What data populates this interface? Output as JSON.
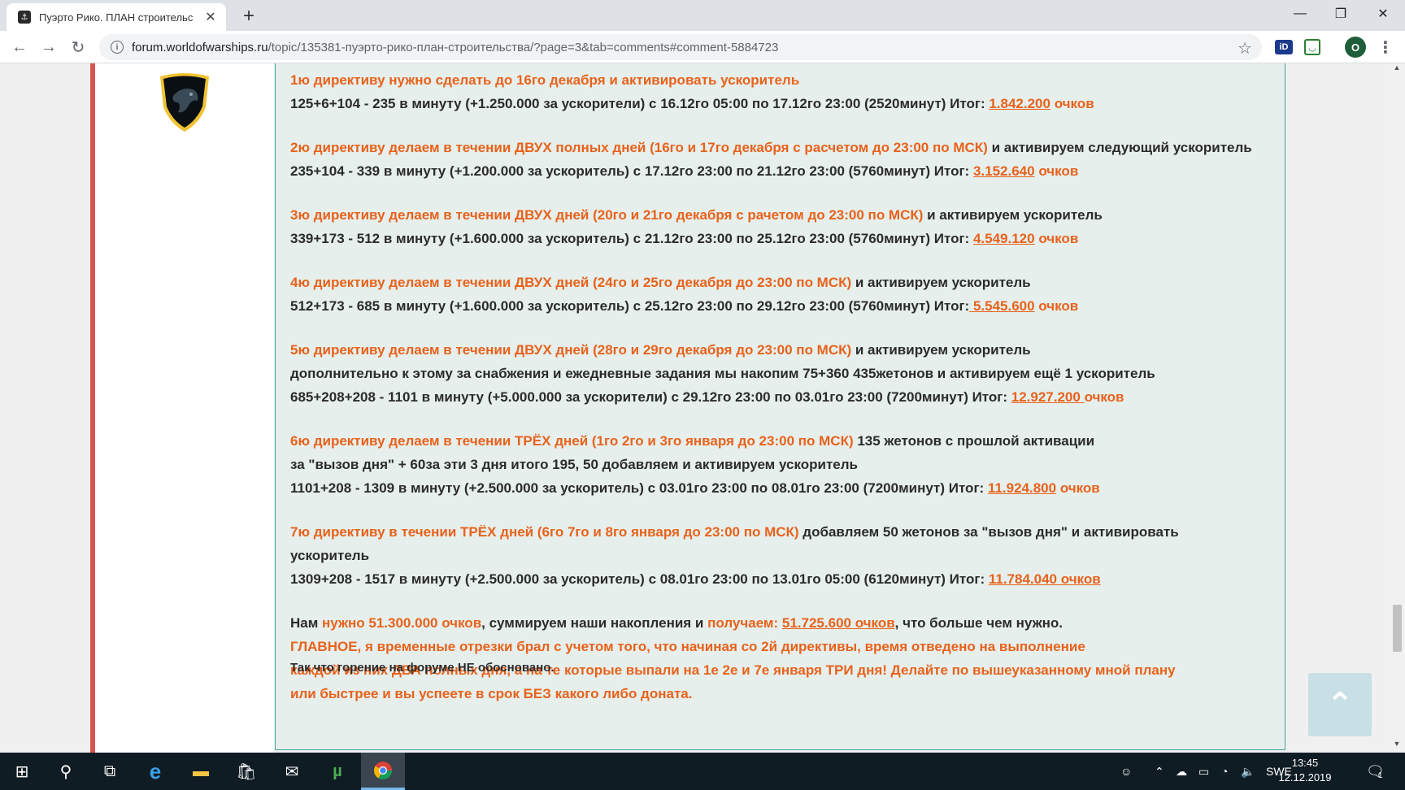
{
  "browser": {
    "tab_title": "Пуэрто Рико. ПЛАН строительс",
    "url_host": "forum.worldofwarships.ru",
    "url_path": "/topic/135381-пуэрто-рико-план-строительства/?page=3&tab=comments#comment-5884723",
    "profile_initial": "O",
    "ext_id_label": "iD"
  },
  "post": {
    "paragraphs": [
      [
        [
          {
            "t": "1ю директиву нужно сделать до 16го декабря и активировать ускоритель",
            "c": "o"
          }
        ],
        [
          {
            "t": "125+6+104 - 235 в минуту (+1.250.000 за ускорители) с 16.12го 05:00 по 17.12го 23:00 (2520минут) Итог: ",
            "c": "d"
          },
          {
            "t": "1.842.200",
            "c": "lk"
          },
          {
            "t": " очков",
            "c": "o"
          }
        ]
      ],
      [
        [
          {
            "t": "2ю директиву делаем в течении ДВУХ полных дней (16го и 17го декабря с расчетом до 23:00 по МСК)",
            "c": "o"
          },
          {
            "t": " и активируем следующий ускоритель",
            "c": "d"
          }
        ],
        [
          {
            "t": "235+104 - 339 в минуту (+1.200.000 за ускоритель) с 17.12го 23:00 по 21.12го 23:00 (5760минут) Итог: ",
            "c": "d"
          },
          {
            "t": "3.152.640",
            "c": "lk"
          },
          {
            "t": " очков",
            "c": "o"
          }
        ]
      ],
      [
        [
          {
            "t": "3ю директиву делаем в течении ДВУХ дней (20го и 21го декабря с рачетом до 23:00 по МСК)",
            "c": "o"
          },
          {
            "t": " и активируем ускоритель",
            "c": "d"
          }
        ],
        [
          {
            "t": "339+173 - 512 в минуту (+1.600.000 за ускоритель) с 21.12го 23:00 по 25.12го 23:00 (5760минут) Итог: ",
            "c": "d"
          },
          {
            "t": "4.549.120",
            "c": "lk"
          },
          {
            "t": " очков",
            "c": "o"
          }
        ]
      ],
      [
        [
          {
            "t": "4ю директиву делаем в течении ДВУХ дней (24го и 25го декабря до 23:00 по МСК)",
            "c": "o"
          },
          {
            "t": " и активируем ускоритель",
            "c": "d"
          }
        ],
        [
          {
            "t": "512+173 - 685 в минуту (+1.600.000 за ускоритель) с 25.12го 23:00 по 29.12го 23:00 (5760минут) Итог:",
            "c": "d"
          },
          {
            "t": " 5.545.600",
            "c": "lk"
          },
          {
            "t": " очков",
            "c": "o"
          }
        ]
      ],
      [
        [
          {
            "t": "5ю директиву делаем в течении ДВУХ дней (28го и 29го декабря до 23:00 по МСК)",
            "c": "o"
          },
          {
            "t": " и активируем ускоритель",
            "c": "d"
          }
        ],
        [
          {
            "t": "дополнительно к этому за снабжения и ежедневные задания мы накопим 75+360 435жетонов и активируем ещё 1 ускоритель",
            "c": "d"
          }
        ],
        [
          {
            "t": "685+208+208 - 1101 в минуту (+5.000.000 за ускорители) с 29.12го 23:00 по 03.01го 23:00 (7200минут) Итог: ",
            "c": "d"
          },
          {
            "t": "12.927.200 ",
            "c": "lk"
          },
          {
            "t": "очков",
            "c": "o"
          }
        ]
      ],
      [
        [
          {
            "t": "6ю директиву делаем в течении ТРЁХ дней (1го 2го и 3го января до 23:00 по МСК)",
            "c": "o"
          },
          {
            "t": " 135 жетонов с прошлой активации",
            "c": "d"
          }
        ],
        [
          {
            "t": "за \"вызов дня\" + 60за эти 3 дня итого 195, 50 добавляем и активируем ускоритель",
            "c": "d"
          }
        ],
        [
          {
            "t": "1101+208 - 1309 в минуту (+2.500.000 за ускоритель) с 03.01го 23:00 по 08.01го 23:00 (7200минут) Итог: ",
            "c": "d"
          },
          {
            "t": "11.924.800",
            "c": "lk"
          },
          {
            "t": " очков",
            "c": "o"
          }
        ]
      ],
      [
        [
          {
            "t": " 7ю директиву в течении ТРЁХ дней (6го 7го и 8го января до 23:00 по МСК)",
            "c": "o"
          },
          {
            "t": " добавляем 50 жетонов за \"вызов дня\" и активировать",
            "c": "d"
          }
        ],
        [
          {
            "t": "ускоритель",
            "c": "d"
          }
        ],
        [
          {
            "t": "1309+208 - 1517 в минуту (+2.500.000 за ускоритель) с 08.01го 23:00 по 13.01го 05:00 (6120минут) Итог: ",
            "c": "d"
          },
          {
            "t": "11.784.040 очков",
            "c": "lk"
          }
        ]
      ],
      [
        [
          {
            "t": "Нам ",
            "c": "d"
          },
          {
            "t": "нужно 51.300.000 очков",
            "c": "o"
          },
          {
            "t": ", суммируем наши накопления и ",
            "c": "d"
          },
          {
            "t": "получаем: ",
            "c": "o"
          },
          {
            "t": "51.725.600 очков",
            "c": "lk"
          },
          {
            "t": ", что больше чем нужно.",
            "c": "d"
          }
        ],
        [
          {
            "t": "ГЛАВНОЕ, я временные отрезки брал с учетом того, что начиная со 2й директивы, время отведено на выполнение",
            "c": "o"
          }
        ],
        [
          {
            "t": " каждой из них ДВА полных дня, а на те которые выпали на 1е 2е и 7е января ТРИ дня! Делайте по вышеуказанному мной плану",
            "c": "o"
          }
        ],
        [
          {
            "t": " или быстрее и вы успеете в срок БЕЗ какого либо доната.",
            "c": "o"
          }
        ]
      ]
    ],
    "final_note": "Так что горение на форуме НЕ обосновано."
  },
  "taskbar": {
    "lang": "SWE",
    "time": "13:45",
    "date": "12.12.2019",
    "notification_count": "1"
  },
  "colors": {
    "accent_orange": "#e8621b",
    "post_border": "#4aa79a",
    "post_bg": "#e6efec",
    "rank_bar": "#d9534f"
  }
}
